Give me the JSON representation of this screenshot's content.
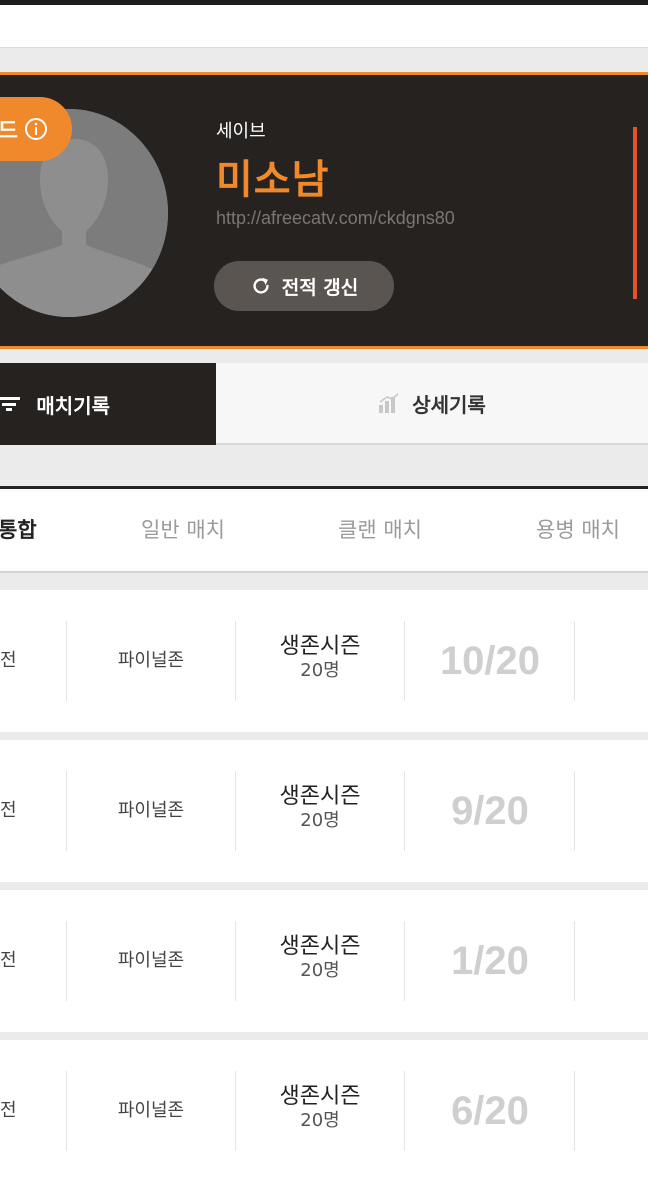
{
  "profile": {
    "badge_label": "드",
    "team": "세이브",
    "nickname": "미소남",
    "url": "http://afreecatv.com/ckdgns80",
    "refresh_label": "전적 갱신",
    "accent_color": "#f0892b"
  },
  "tabs": [
    {
      "label": "매치기록",
      "icon": "list-icon",
      "active": true
    },
    {
      "label": "상세기록",
      "icon": "bar-chart-icon",
      "active": false
    }
  ],
  "filters": [
    {
      "label": "통합",
      "active": true
    },
    {
      "label": "일반 매치",
      "active": false
    },
    {
      "label": "클랜 매치",
      "active": false
    },
    {
      "label": "용병 매치",
      "active": false
    }
  ],
  "matches": [
    {
      "mode": "전",
      "map": "파이널존",
      "type": "생존시즌",
      "players": "20명",
      "rank": "10/20"
    },
    {
      "mode": "전",
      "map": "파이널존",
      "type": "생존시즌",
      "players": "20명",
      "rank": "9/20"
    },
    {
      "mode": "전",
      "map": "파이널존",
      "type": "생존시즌",
      "players": "20명",
      "rank": "1/20"
    },
    {
      "mode": "전",
      "map": "파이널존",
      "type": "생존시즌",
      "players": "20명",
      "rank": "6/20"
    }
  ]
}
